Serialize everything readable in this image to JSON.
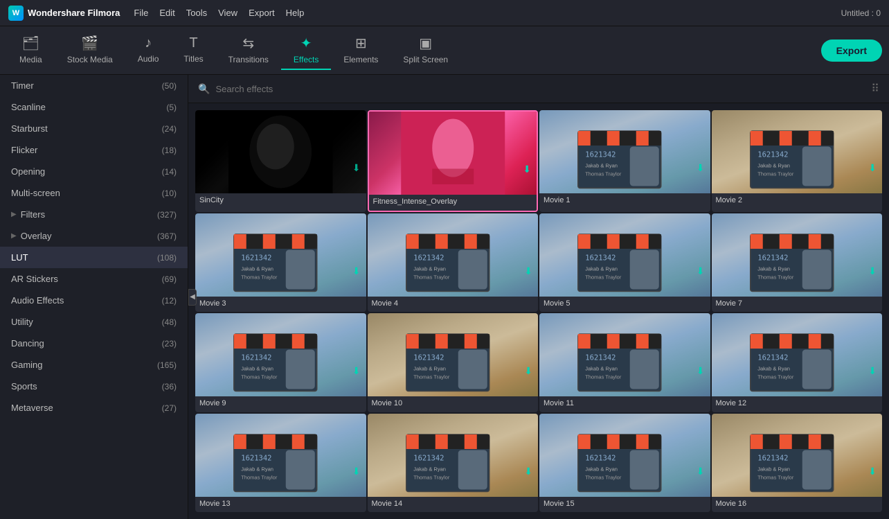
{
  "app": {
    "name": "Wondershare Filmora",
    "window_title": "Untitled : 0"
  },
  "menu": {
    "items": [
      "File",
      "Edit",
      "Tools",
      "View",
      "Export",
      "Help"
    ]
  },
  "toolbar": {
    "items": [
      {
        "id": "media",
        "label": "Media",
        "icon": "📁"
      },
      {
        "id": "stock-media",
        "label": "Stock Media",
        "icon": "🎬"
      },
      {
        "id": "audio",
        "label": "Audio",
        "icon": "♪"
      },
      {
        "id": "titles",
        "label": "Titles",
        "icon": "T"
      },
      {
        "id": "transitions",
        "label": "Transitions",
        "icon": "⇄"
      },
      {
        "id": "effects",
        "label": "Effects",
        "icon": "✦"
      },
      {
        "id": "elements",
        "label": "Elements",
        "icon": "⊞"
      },
      {
        "id": "split-screen",
        "label": "Split Screen",
        "icon": "▣"
      }
    ],
    "active": "effects",
    "export_label": "Export"
  },
  "sidebar": {
    "items": [
      {
        "id": "timer",
        "label": "Timer",
        "count": 50,
        "has_arrow": false
      },
      {
        "id": "scanline",
        "label": "Scanline",
        "count": 5,
        "has_arrow": false
      },
      {
        "id": "starburst",
        "label": "Starburst",
        "count": 24,
        "has_arrow": false
      },
      {
        "id": "flicker",
        "label": "Flicker",
        "count": 18,
        "has_arrow": false
      },
      {
        "id": "opening",
        "label": "Opening",
        "count": 14,
        "has_arrow": false
      },
      {
        "id": "multi-screen",
        "label": "Multi-screen",
        "count": 10,
        "has_arrow": false
      },
      {
        "id": "filters",
        "label": "Filters",
        "count": 327,
        "has_arrow": true
      },
      {
        "id": "overlay",
        "label": "Overlay",
        "count": 367,
        "has_arrow": true
      },
      {
        "id": "lut",
        "label": "LUT",
        "count": 108,
        "has_arrow": false,
        "active": true
      },
      {
        "id": "ar-stickers",
        "label": "AR Stickers",
        "count": 69,
        "has_arrow": false
      },
      {
        "id": "audio-effects",
        "label": "Audio Effects",
        "count": 12,
        "has_arrow": false
      },
      {
        "id": "utility",
        "label": "Utility",
        "count": 48,
        "has_arrow": false
      },
      {
        "id": "dancing",
        "label": "Dancing",
        "count": 23,
        "has_arrow": false
      },
      {
        "id": "gaming",
        "label": "Gaming",
        "count": 165,
        "has_arrow": false
      },
      {
        "id": "sports",
        "label": "Sports",
        "count": 36,
        "has_arrow": false
      },
      {
        "id": "metaverse",
        "label": "Metaverse",
        "count": 27,
        "has_arrow": false
      }
    ]
  },
  "search": {
    "placeholder": "Search effects"
  },
  "grid": {
    "items": [
      {
        "id": "sincity",
        "label": "SinCity",
        "style": "sincity",
        "highlighted": false
      },
      {
        "id": "fitness",
        "label": "Fitness_Intense_Overlay",
        "style": "fitness",
        "highlighted": true
      },
      {
        "id": "movie1",
        "label": "Movie 1",
        "style": "movie",
        "highlighted": false
      },
      {
        "id": "movie2",
        "label": "Movie 2",
        "style": "movie-warm",
        "highlighted": false
      },
      {
        "id": "movie3",
        "label": "Movie 3",
        "style": "movie",
        "highlighted": false
      },
      {
        "id": "movie4",
        "label": "Movie 4",
        "style": "movie",
        "highlighted": false
      },
      {
        "id": "movie5",
        "label": "Movie 5",
        "style": "movie",
        "highlighted": false
      },
      {
        "id": "movie7",
        "label": "Movie 7",
        "style": "movie",
        "highlighted": false
      },
      {
        "id": "movie9",
        "label": "Movie 9",
        "style": "movie",
        "highlighted": false
      },
      {
        "id": "movie10",
        "label": "Movie 10",
        "style": "movie-warm",
        "highlighted": false
      },
      {
        "id": "movie11",
        "label": "Movie 11",
        "style": "movie",
        "highlighted": false
      },
      {
        "id": "movie12",
        "label": "Movie 12",
        "style": "movie",
        "highlighted": false
      },
      {
        "id": "movie13",
        "label": "Movie 13",
        "style": "movie",
        "highlighted": false
      },
      {
        "id": "movie14",
        "label": "Movie 14",
        "style": "movie-warm",
        "highlighted": false
      },
      {
        "id": "movie15",
        "label": "Movie 15",
        "style": "movie",
        "highlighted": false
      },
      {
        "id": "movie16",
        "label": "Movie 16",
        "style": "movie-warm",
        "highlighted": false
      }
    ]
  }
}
